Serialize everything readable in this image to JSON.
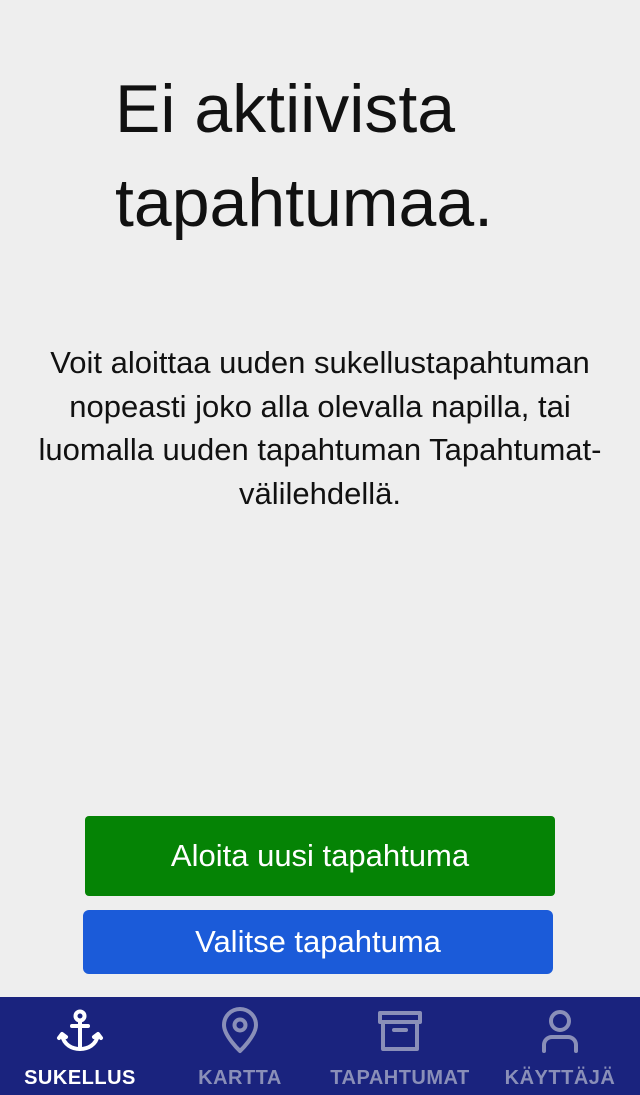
{
  "main": {
    "title": "Ei aktiivista tapahtumaa.",
    "description": "Voit aloittaa uuden sukellustapahtuman nopeasti joko alla olevalla napilla, tai luomalla uuden tapahtuman Tapahtumat-välilehdellä."
  },
  "buttons": {
    "start_label": "Aloita uusi tapahtuma",
    "select_label": "Valitse tapahtuma"
  },
  "tabbar": {
    "items": [
      {
        "label": "SUKELLUS",
        "icon": "anchor-icon",
        "active": true
      },
      {
        "label": "KARTTA",
        "icon": "map-pin-icon",
        "active": false
      },
      {
        "label": "TAPAHTUMAT",
        "icon": "archive-icon",
        "active": false
      },
      {
        "label": "KÄYTTÄJÄ",
        "icon": "user-icon",
        "active": false
      }
    ]
  },
  "colors": {
    "background": "#eeeeee",
    "primary_button": "#058305",
    "secondary_button": "#1b5bd9",
    "tabbar": "#1a237e",
    "tab_active": "#ffffff",
    "tab_inactive": "#8a8fb8"
  }
}
